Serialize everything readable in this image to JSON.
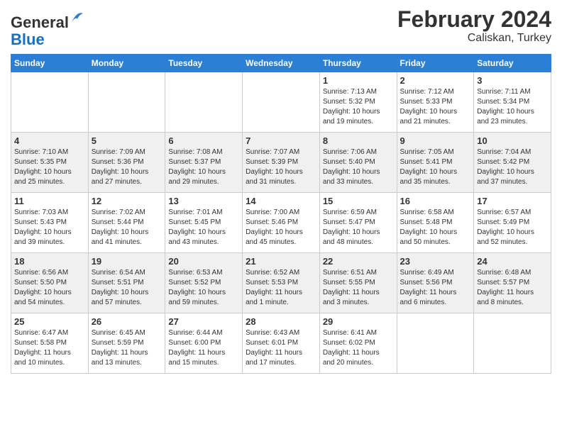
{
  "header": {
    "logo_line1": "General",
    "logo_line2": "Blue",
    "title": "February 2024",
    "subtitle": "Caliskan, Turkey"
  },
  "weekdays": [
    "Sunday",
    "Monday",
    "Tuesday",
    "Wednesday",
    "Thursday",
    "Friday",
    "Saturday"
  ],
  "weeks": [
    [
      {
        "day": "",
        "info": ""
      },
      {
        "day": "",
        "info": ""
      },
      {
        "day": "",
        "info": ""
      },
      {
        "day": "",
        "info": ""
      },
      {
        "day": "1",
        "info": "Sunrise: 7:13 AM\nSunset: 5:32 PM\nDaylight: 10 hours\nand 19 minutes."
      },
      {
        "day": "2",
        "info": "Sunrise: 7:12 AM\nSunset: 5:33 PM\nDaylight: 10 hours\nand 21 minutes."
      },
      {
        "day": "3",
        "info": "Sunrise: 7:11 AM\nSunset: 5:34 PM\nDaylight: 10 hours\nand 23 minutes."
      }
    ],
    [
      {
        "day": "4",
        "info": "Sunrise: 7:10 AM\nSunset: 5:35 PM\nDaylight: 10 hours\nand 25 minutes."
      },
      {
        "day": "5",
        "info": "Sunrise: 7:09 AM\nSunset: 5:36 PM\nDaylight: 10 hours\nand 27 minutes."
      },
      {
        "day": "6",
        "info": "Sunrise: 7:08 AM\nSunset: 5:37 PM\nDaylight: 10 hours\nand 29 minutes."
      },
      {
        "day": "7",
        "info": "Sunrise: 7:07 AM\nSunset: 5:39 PM\nDaylight: 10 hours\nand 31 minutes."
      },
      {
        "day": "8",
        "info": "Sunrise: 7:06 AM\nSunset: 5:40 PM\nDaylight: 10 hours\nand 33 minutes."
      },
      {
        "day": "9",
        "info": "Sunrise: 7:05 AM\nSunset: 5:41 PM\nDaylight: 10 hours\nand 35 minutes."
      },
      {
        "day": "10",
        "info": "Sunrise: 7:04 AM\nSunset: 5:42 PM\nDaylight: 10 hours\nand 37 minutes."
      }
    ],
    [
      {
        "day": "11",
        "info": "Sunrise: 7:03 AM\nSunset: 5:43 PM\nDaylight: 10 hours\nand 39 minutes."
      },
      {
        "day": "12",
        "info": "Sunrise: 7:02 AM\nSunset: 5:44 PM\nDaylight: 10 hours\nand 41 minutes."
      },
      {
        "day": "13",
        "info": "Sunrise: 7:01 AM\nSunset: 5:45 PM\nDaylight: 10 hours\nand 43 minutes."
      },
      {
        "day": "14",
        "info": "Sunrise: 7:00 AM\nSunset: 5:46 PM\nDaylight: 10 hours\nand 45 minutes."
      },
      {
        "day": "15",
        "info": "Sunrise: 6:59 AM\nSunset: 5:47 PM\nDaylight: 10 hours\nand 48 minutes."
      },
      {
        "day": "16",
        "info": "Sunrise: 6:58 AM\nSunset: 5:48 PM\nDaylight: 10 hours\nand 50 minutes."
      },
      {
        "day": "17",
        "info": "Sunrise: 6:57 AM\nSunset: 5:49 PM\nDaylight: 10 hours\nand 52 minutes."
      }
    ],
    [
      {
        "day": "18",
        "info": "Sunrise: 6:56 AM\nSunset: 5:50 PM\nDaylight: 10 hours\nand 54 minutes."
      },
      {
        "day": "19",
        "info": "Sunrise: 6:54 AM\nSunset: 5:51 PM\nDaylight: 10 hours\nand 57 minutes."
      },
      {
        "day": "20",
        "info": "Sunrise: 6:53 AM\nSunset: 5:52 PM\nDaylight: 10 hours\nand 59 minutes."
      },
      {
        "day": "21",
        "info": "Sunrise: 6:52 AM\nSunset: 5:53 PM\nDaylight: 11 hours\nand 1 minute."
      },
      {
        "day": "22",
        "info": "Sunrise: 6:51 AM\nSunset: 5:55 PM\nDaylight: 11 hours\nand 3 minutes."
      },
      {
        "day": "23",
        "info": "Sunrise: 6:49 AM\nSunset: 5:56 PM\nDaylight: 11 hours\nand 6 minutes."
      },
      {
        "day": "24",
        "info": "Sunrise: 6:48 AM\nSunset: 5:57 PM\nDaylight: 11 hours\nand 8 minutes."
      }
    ],
    [
      {
        "day": "25",
        "info": "Sunrise: 6:47 AM\nSunset: 5:58 PM\nDaylight: 11 hours\nand 10 minutes."
      },
      {
        "day": "26",
        "info": "Sunrise: 6:45 AM\nSunset: 5:59 PM\nDaylight: 11 hours\nand 13 minutes."
      },
      {
        "day": "27",
        "info": "Sunrise: 6:44 AM\nSunset: 6:00 PM\nDaylight: 11 hours\nand 15 minutes."
      },
      {
        "day": "28",
        "info": "Sunrise: 6:43 AM\nSunset: 6:01 PM\nDaylight: 11 hours\nand 17 minutes."
      },
      {
        "day": "29",
        "info": "Sunrise: 6:41 AM\nSunset: 6:02 PM\nDaylight: 11 hours\nand 20 minutes."
      },
      {
        "day": "",
        "info": ""
      },
      {
        "day": "",
        "info": ""
      }
    ]
  ]
}
